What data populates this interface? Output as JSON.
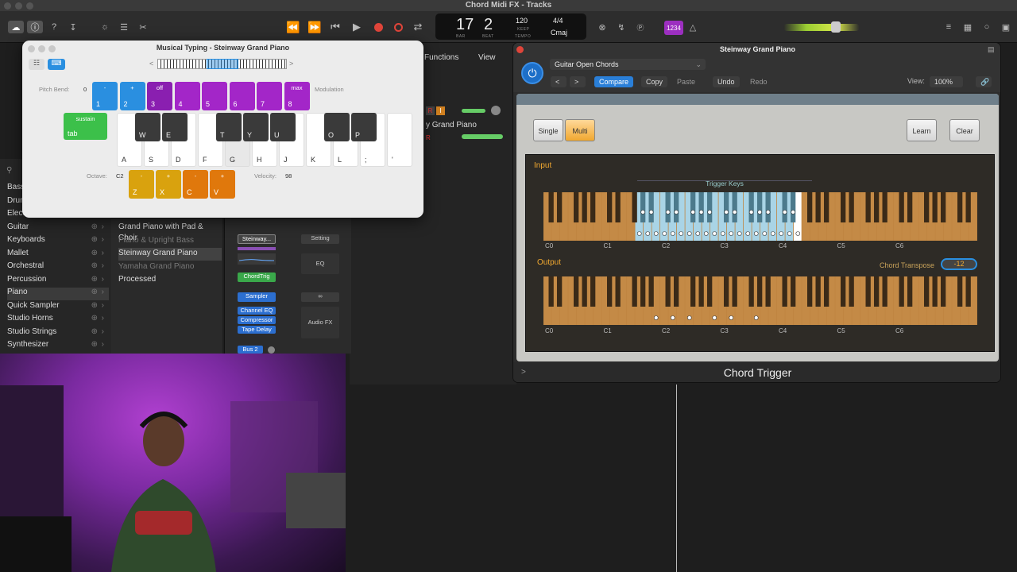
{
  "window_title": "Chord Midi FX - Tracks",
  "transport": {
    "bar": "17",
    "beat": "2",
    "bar_label": "BAR",
    "beat_label": "BEAT",
    "tempo": "120",
    "keep": "KEEP",
    "tempo_label": "TEMPO",
    "signature": "4/4",
    "key": "Cmaj",
    "count_in": "1234"
  },
  "colors": {
    "record": "#e0453a",
    "accent": "#f0a830",
    "blue": "#2a7fd8"
  },
  "library": {
    "search_icon": "search-icon",
    "items": [
      {
        "label": "Bass",
        "y": 0
      },
      {
        "label": "Drums"
      },
      {
        "label": "Electronic"
      },
      {
        "label": "Guitar"
      },
      {
        "label": "Keyboards"
      },
      {
        "label": "Mallet"
      },
      {
        "label": "Orchestral"
      },
      {
        "label": "Percussion"
      },
      {
        "label": "Piano",
        "selected": true
      },
      {
        "label": "Quick Sampler"
      },
      {
        "label": "Studio Horns"
      },
      {
        "label": "Studio Strings"
      },
      {
        "label": "Synthesizer"
      }
    ],
    "patches": [
      {
        "label": "Grand Piano with Pad & Choir"
      },
      {
        "label": "Piano & Upright Bass",
        "dim": true
      },
      {
        "label": "Steinway Grand Piano",
        "selected": true
      },
      {
        "label": "Yamaha Grand Piano",
        "dim": true
      },
      {
        "label": "Processed"
      }
    ]
  },
  "strip": {
    "instrument": "Steinway...",
    "midi_fx": "ChordTrig",
    "sampler": "Sampler",
    "effects": [
      "Channel EQ",
      "Compressor",
      "Tape Delay"
    ],
    "bus": "Bus 2",
    "setting": "Setting",
    "eq": "EQ",
    "audio_fx": "Audio FX"
  },
  "tracks_header": {
    "functions": "Functions",
    "view": "View",
    "track_name": "y Grand Piano",
    "r": "R",
    "i": "I"
  },
  "musical_typing": {
    "title": "Musical Typing - Steinway Grand Piano",
    "pitch_bend_label": "Pitch Bend:",
    "pitch_bend_value": "0",
    "modulation_label": "Modulation",
    "octave_label": "Octave:",
    "octave_value": "C2",
    "velocity_label": "Velocity:",
    "velocity_value": "98",
    "sustain": {
      "hi": "sustain",
      "lo": "tab"
    },
    "pitch_keys": [
      {
        "hi": "-",
        "lo": "1",
        "color": "#2a8fe0"
      },
      {
        "hi": "+",
        "lo": "2",
        "color": "#2a8fe0"
      },
      {
        "hi": "off",
        "lo": "3",
        "color": "#8a1fb0"
      },
      {
        "hi": "",
        "lo": "4",
        "color": "#a326c8"
      },
      {
        "hi": "",
        "lo": "5",
        "color": "#a326c8"
      },
      {
        "hi": "",
        "lo": "6",
        "color": "#a326c8"
      },
      {
        "hi": "",
        "lo": "7",
        "color": "#a326c8"
      },
      {
        "hi": "max",
        "lo": "8",
        "color": "#a326c8"
      }
    ],
    "white_keys": [
      "A",
      "S",
      "D",
      "F",
      "G",
      "H",
      "J",
      "K",
      "L",
      ";",
      "'"
    ],
    "black_keys": [
      "W",
      "E",
      "T",
      "Y",
      "U",
      "O",
      "P"
    ],
    "octave_keys": [
      {
        "hi": "-",
        "lo": "Z",
        "color": "#d9a20e"
      },
      {
        "hi": "+",
        "lo": "X",
        "color": "#d9a20e"
      },
      {
        "hi": "-",
        "lo": "C",
        "color": "#e0780c"
      },
      {
        "hi": "+",
        "lo": "V",
        "color": "#e0780c"
      }
    ]
  },
  "chord_trigger": {
    "window_title": "Steinway Grand Piano",
    "preset": "Guitar Open Chords",
    "compare": "Compare",
    "copy": "Copy",
    "paste": "Paste",
    "undo": "Undo",
    "redo": "Redo",
    "view_label": "View:",
    "view_value": "100%",
    "single": "Single",
    "multi": "Multi",
    "learn": "Learn",
    "clear": "Clear",
    "input_label": "Input",
    "output_label": "Output",
    "trigger_keys": "Trigger Keys",
    "chord_transpose_label": "Chord Transpose",
    "chord_transpose_value": "-12",
    "octave_labels": [
      "C0",
      "C1",
      "C2",
      "C3",
      "C4",
      "C5",
      "C6"
    ],
    "plugin_name": "Chord Trigger"
  }
}
